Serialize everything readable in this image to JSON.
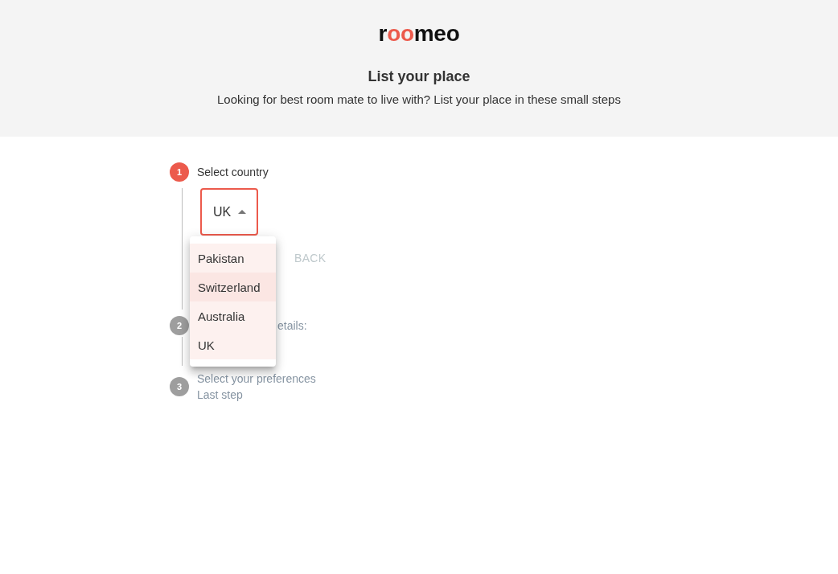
{
  "header": {
    "logo": [
      {
        "text": "r",
        "accent": false
      },
      {
        "text": "oo",
        "accent": true
      },
      {
        "text": "meo",
        "accent": false
      }
    ],
    "title": "List your place",
    "subtitle": "Looking for best room mate to live with? List your place in these small steps"
  },
  "steps": [
    {
      "number": "1",
      "label": "Select country",
      "active": true,
      "field": {
        "value": "UK",
        "expanded": true
      },
      "buttons": [
        {
          "label": "BACK",
          "disabled": true
        }
      ],
      "menu": [
        {
          "label": "Pakistan",
          "selected": false
        },
        {
          "label": "Switzerland",
          "selected": true
        },
        {
          "label": "Australia",
          "selected": false
        },
        {
          "label": "UK",
          "selected": false
        }
      ]
    },
    {
      "number": "2",
      "label": "etails:",
      "active": false
    },
    {
      "number": "3",
      "label": "Select your preferences",
      "sublabel": "Last step",
      "active": false
    }
  ]
}
